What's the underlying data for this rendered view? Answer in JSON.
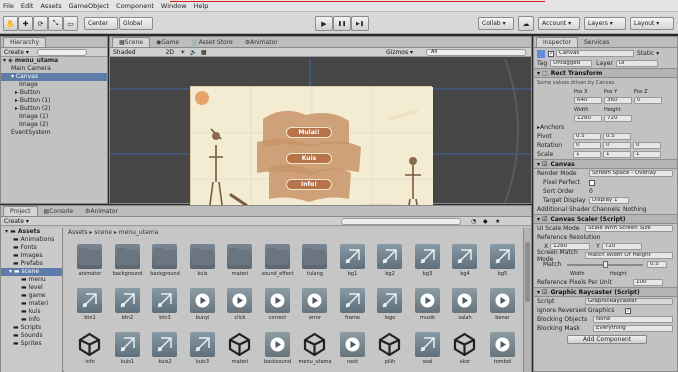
{
  "menu": [
    "File",
    "Edit",
    "Assets",
    "GameObject",
    "Component",
    "Window",
    "Help"
  ],
  "toolbar": {
    "pivot": "Center",
    "space": "Global",
    "play": "▶",
    "pause": "❚❚",
    "step": "▶❚",
    "collab": "Collab ▾",
    "account": "Account ▾",
    "layers": "Layers ▾",
    "layout": "Layout ▾"
  },
  "hierarchy": {
    "tab": "Hierarchy",
    "create": "Create ▾",
    "scene": "menu_utama",
    "items": [
      "Main Camera",
      "Canvas",
      "Image",
      "Button",
      "Button (1)",
      "Button (2)",
      "Image (1)",
      "Image (2)",
      "EventSystem"
    ]
  },
  "scene": {
    "tabs": [
      "Scene",
      "Game",
      "Asset Store",
      "Animator"
    ],
    "shading": "Shaded",
    "mode": "2D",
    "gizmos": "Gizmos ▾",
    "search": "All",
    "buttons": [
      "Mulai!",
      "Kuis",
      "Info!"
    ]
  },
  "inspector": {
    "tabs": [
      "Inspector",
      "Services"
    ],
    "object_name": "Canvas",
    "static": "Static ▾",
    "tag_label": "Tag",
    "tag": "Untagged",
    "layer_label": "Layer",
    "layer": "UI",
    "rect_transform": "Rect Transform",
    "rect_note": "Some values driven by Canvas.",
    "pos_labels": [
      "Pos X",
      "Pos Y",
      "Pos Z"
    ],
    "pos_values": [
      "640",
      "360",
      "0"
    ],
    "size_labels": [
      "Width",
      "Height"
    ],
    "size_values": [
      "1280",
      "720"
    ],
    "anchors": "Anchors",
    "pivot_label": "Pivot",
    "pivot": [
      "0.5",
      "0.5"
    ],
    "rotation_label": "Rotation",
    "rotation": [
      "0",
      "0",
      "0"
    ],
    "scale_label": "Scale",
    "scale": [
      "1",
      "1",
      "1"
    ],
    "canvas": "Canvas",
    "render_mode_label": "Render Mode",
    "render_mode": "Screen Space - Overlay",
    "pixel_perfect": "Pixel Perfect",
    "sort_order_label": "Sort Order",
    "sort_order": "0",
    "target_display_label": "Target Display",
    "target_display": "Display 1",
    "shader_channels_label": "Additional Shader Channels",
    "shader_channels": "Nothing",
    "canvas_scaler": "Canvas Scaler (Script)",
    "ui_scale_label": "UI Scale Mode",
    "ui_scale": "Scale With Screen Size",
    "ref_res_label": "Reference Resolution",
    "ref_res": [
      "1280",
      "720"
    ],
    "match_label": "Screen Match Mode",
    "match": "Match Width Or Height",
    "match_value_label": "Match",
    "match_value": "0.5",
    "width_label": "Width",
    "height_label": "Height",
    "ref_ppu_label": "Reference Pixels Per Unit",
    "ref_ppu": "100",
    "raycaster": "Graphic Raycaster (Script)",
    "script_label": "Script",
    "script": "GraphicRaycaster",
    "ignore_label": "Ignore Reversed Graphics",
    "blocking_obj_label": "Blocking Objects",
    "blocking_obj": "None",
    "blocking_mask_label": "Blocking Mask",
    "blocking_mask": "Everything",
    "add_component": "Add Component"
  },
  "project": {
    "tabs": [
      "Project",
      "Console",
      "Animator"
    ],
    "create": "Create ▾",
    "breadcrumb": "Assets ▸ scene ▸ menu_utama",
    "folders": [
      "Assets",
      "Animations",
      "Fonts",
      "Images",
      "Prefabs",
      "scene",
      "menu",
      "level",
      "game",
      "materi",
      "kuis",
      "info",
      "Scripts",
      "Sounds",
      "Sprites"
    ],
    "assets": [
      {
        "name": "animator",
        "kind": "folder"
      },
      {
        "name": "background",
        "kind": "folder"
      },
      {
        "name": "background",
        "kind": "folder"
      },
      {
        "name": "kuis",
        "kind": "folder"
      },
      {
        "name": "materi",
        "kind": "folder"
      },
      {
        "name": "sound_effect",
        "kind": "folder"
      },
      {
        "name": "tulang",
        "kind": "folder"
      },
      {
        "name": "bg1",
        "kind": "sprite"
      },
      {
        "name": "bg2",
        "kind": "sprite"
      },
      {
        "name": "bg3",
        "kind": "sprite"
      },
      {
        "name": "bg4",
        "kind": "sprite"
      },
      {
        "name": "bg5",
        "kind": "sprite"
      },
      {
        "name": "btn1",
        "kind": "sprite"
      },
      {
        "name": "btn2",
        "kind": "sprite"
      },
      {
        "name": "btn3",
        "kind": "sprite"
      },
      {
        "name": "bunyi",
        "kind": "audio"
      },
      {
        "name": "click",
        "kind": "audio"
      },
      {
        "name": "correct",
        "kind": "audio"
      },
      {
        "name": "error",
        "kind": "audio"
      },
      {
        "name": "frame",
        "kind": "sprite"
      },
      {
        "name": "logo",
        "kind": "sprite"
      },
      {
        "name": "musik",
        "kind": "audio"
      },
      {
        "name": "salah",
        "kind": "audio"
      },
      {
        "name": "benar",
        "kind": "audio"
      },
      {
        "name": "info",
        "kind": "unity"
      },
      {
        "name": "kuis1",
        "kind": "sprite"
      },
      {
        "name": "kuis2",
        "kind": "sprite"
      },
      {
        "name": "kuis3",
        "kind": "sprite"
      },
      {
        "name": "materi",
        "kind": "unity"
      },
      {
        "name": "backsound",
        "kind": "audio"
      },
      {
        "name": "menu_utama",
        "kind": "unity"
      },
      {
        "name": "next",
        "kind": "audio"
      },
      {
        "name": "pilih",
        "kind": "unity"
      },
      {
        "name": "soal",
        "kind": "sprite"
      },
      {
        "name": "skor",
        "kind": "unity"
      },
      {
        "name": "tombol",
        "kind": "audio"
      }
    ]
  }
}
